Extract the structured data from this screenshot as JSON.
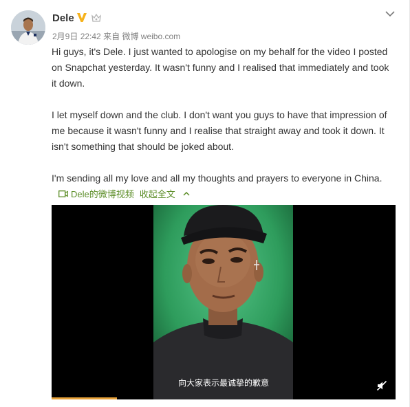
{
  "user": {
    "name": "Dele"
  },
  "meta": {
    "date": "2月9日",
    "time": "22:42",
    "source_prefix": "来自",
    "source_name": "微博 weibo.com"
  },
  "post": {
    "paragraphs": [
      "Hi guys, it's Dele. I just wanted to apologise on my behalf for the video I posted on Snapchat yesterday. It wasn't funny and I realised that immediately and took it down.",
      "I let myself down and the club. I don't want you guys to have that impression of me because it wasn't funny and I realise that straight away and took it down. It isn't something that should be joked about.",
      "I'm sending all my love and all my thoughts and prayers to everyone in China."
    ]
  },
  "video_link": {
    "label": "Dele的微博视频",
    "collapse_label": "收起全文"
  },
  "video": {
    "caption": "向大家表示最诚挚的歉意",
    "progress": 0.19
  },
  "colors": {
    "link_green": "#5a8c25",
    "verified_orange": "#f6b21b",
    "progress_orange": "#e8a33b"
  },
  "icons": {
    "verified": "verified-v-icon",
    "member": "crown-icon",
    "menu": "chevron-down-icon",
    "video": "video-icon",
    "collapse": "chevron-up-icon",
    "mute": "mute-icon"
  }
}
